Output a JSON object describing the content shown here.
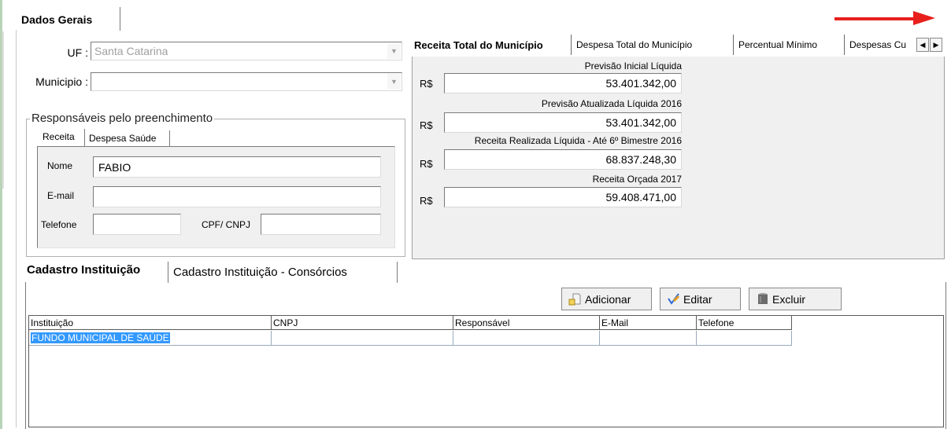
{
  "main_tab": "Dados Gerais",
  "uf": {
    "label": "UF :",
    "value": "Santa Catarina"
  },
  "municipio": {
    "label": "Municipio :",
    "value": ""
  },
  "responsaveis": {
    "title": "Responsáveis pelo preenchimento",
    "tabs": [
      "Receita",
      "Despesa Saúde"
    ],
    "nome_label": "Nome",
    "nome_value": "FABIO",
    "email_label": "E-mail",
    "telefone_label": "Telefone",
    "cpf_label": "CPF/ CNPJ"
  },
  "receita": {
    "tabs": [
      "Receita Total do Município",
      "Despesa Total do Município",
      "Percentual Mínimo",
      "Despesas Cu"
    ],
    "currency": "R$",
    "fields": [
      {
        "caption": "Previsão Inicial Líquida",
        "value": "53.401.342,00"
      },
      {
        "caption": "Previsão Atualizada Líquida  2016",
        "value": "53.401.342,00"
      },
      {
        "caption": "Receita Realizada Líquida  - Até 6º Bimestre 2016",
        "value": "68.837.248,30"
      },
      {
        "caption": "Receita Orçada 2017",
        "value": "59.408.471,00"
      }
    ]
  },
  "bottom_tabs": [
    "Cadastro Instituição",
    "Cadastro Instituição - Consórcios"
  ],
  "buttons": {
    "add": "Adicionar",
    "edit": "Editar",
    "delete": "Excluir"
  },
  "grid": {
    "columns": [
      "Instituição",
      "CNPJ",
      "Responsável",
      "E-Mail",
      "Telefone"
    ],
    "rows": [
      [
        "FUNDO MUNICIPAL DE SAÚDE",
        "",
        "",
        "",
        ""
      ]
    ]
  },
  "colors": {
    "arrow": "#e8201c",
    "selection": "#3399ff"
  },
  "icons": [
    "red-arrow-icon",
    "dropdown-arrow-icon",
    "scroll-left-icon",
    "scroll-right-icon",
    "add-document-icon",
    "edit-pencil-icon",
    "trash-icon"
  ]
}
